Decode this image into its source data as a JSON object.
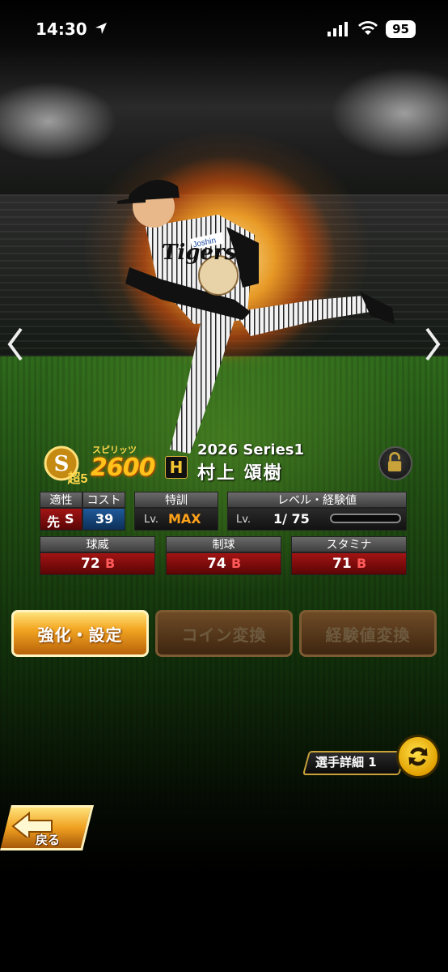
{
  "status_bar": {
    "time": "14:30",
    "battery": "95"
  },
  "card": {
    "rank": "S",
    "rank_sub": "超5",
    "spirits_label": "スピリッツ",
    "spirits_value": "2600",
    "team_logo": "H",
    "series": "2026 Series1",
    "player_name": "村上 頌樹"
  },
  "stats": {
    "aptitude": {
      "label": "適性",
      "value": "先",
      "grade": "S"
    },
    "cost": {
      "label": "コスト",
      "value": "39"
    },
    "training": {
      "label": "特訓",
      "lv_prefix": "Lv.",
      "value": "MAX"
    },
    "level": {
      "label": "レベル・経験値",
      "lv_prefix": "Lv.",
      "value": "1/ 75"
    },
    "velocity": {
      "label": "球威",
      "value": "72",
      "grade": "B"
    },
    "control": {
      "label": "制球",
      "value": "74",
      "grade": "B"
    },
    "stamina": {
      "label": "スタミナ",
      "value": "71",
      "grade": "B"
    }
  },
  "buttons": {
    "enhance": "強化・設定",
    "coin": "コイン変換",
    "exp": "経験値変換",
    "detail": "選手詳細 1",
    "back": "戻る"
  },
  "colors": {
    "accent_gold": "#f3a622",
    "stat_red": "#a31414",
    "cost_blue": "#1f5a9a"
  }
}
